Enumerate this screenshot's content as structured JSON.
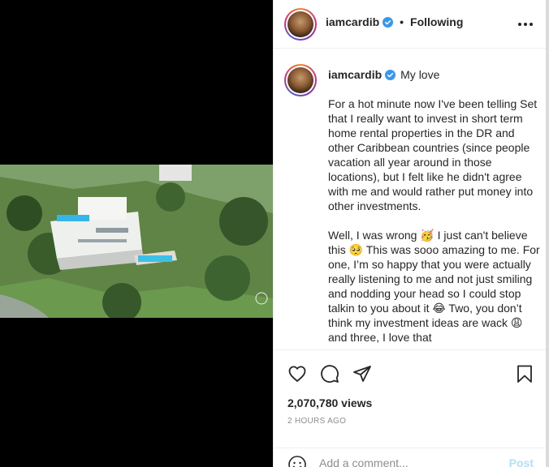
{
  "post": {
    "username": "iamcardib",
    "follow_state": "Following",
    "separator": "•",
    "caption_title": "My love",
    "caption_body": "For a hot minute now I've been telling Set that I really want to invest in short term home rental properties in the DR and other Caribbean countries (since people vacation all year around in those locations), but I felt like he didn't agree with me and would rather put money into other investments.\n\nWell, I was wrong 🥳 I just can't believe this 🥺 This was sooo amazing to me. For one, I’m so happy that you were actually really listening to me and not just smiling and nodding your head so I could stop talkin to you about it 😂 Two, you don’t think my investment ideas are wack 😩and three, I love that",
    "views": "2,070,780 views",
    "time_ago": "2 HOURS AGO"
  },
  "comment": {
    "placeholder": "Add a comment...",
    "post_label": "Post"
  },
  "icons": {
    "header_more": "more-options-icon",
    "verified": "verified-badge-icon",
    "like": "heart-icon",
    "comment": "comment-bubble-icon",
    "share": "paper-plane-icon",
    "save": "bookmark-icon",
    "emoji": "smiley-icon"
  },
  "colors": {
    "verified_blue": "#3897f0",
    "post_disabled": "#b2dffc",
    "muted_text": "#8e8e8e"
  }
}
